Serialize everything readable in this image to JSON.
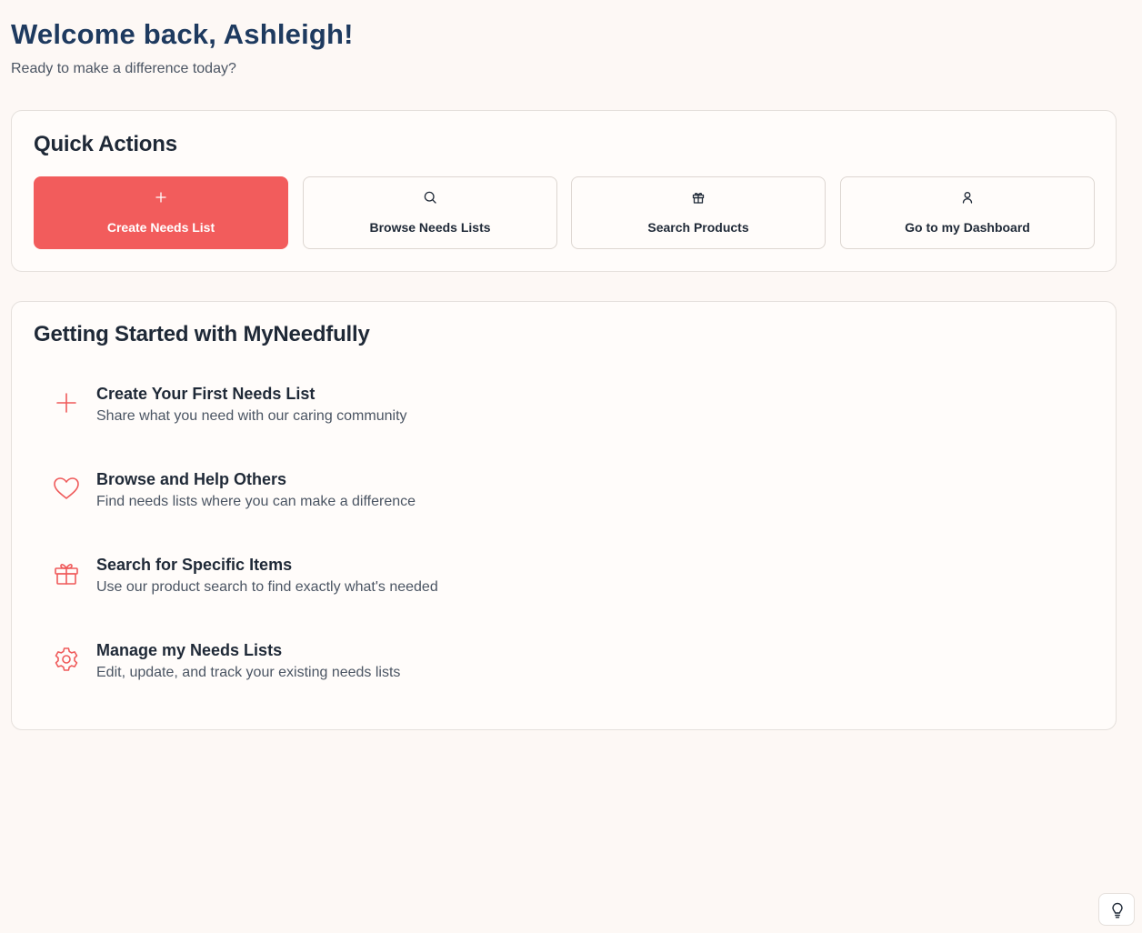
{
  "header": {
    "title": "Welcome back, Ashleigh!",
    "subtitle": "Ready to make a difference today?"
  },
  "quick_actions": {
    "title": "Quick Actions",
    "buttons": [
      {
        "label": "Create Needs List",
        "icon": "plus-icon"
      },
      {
        "label": "Browse Needs Lists",
        "icon": "search-icon"
      },
      {
        "label": "Search Products",
        "icon": "gift-icon"
      },
      {
        "label": "Go to my Dashboard",
        "icon": "user-icon"
      }
    ]
  },
  "getting_started": {
    "title": "Getting Started with MyNeedfully",
    "items": [
      {
        "title": "Create Your First Needs List",
        "description": "Share what you need with our caring community",
        "icon": "plus-icon"
      },
      {
        "title": "Browse and Help Others",
        "description": "Find needs lists where you can make a difference",
        "icon": "heart-icon"
      },
      {
        "title": "Search for Specific Items",
        "description": "Use our product search to find exactly what's needed",
        "icon": "gift-icon"
      },
      {
        "title": "Manage my Needs Lists",
        "description": "Edit, update, and track your existing needs lists",
        "icon": "gear-icon"
      }
    ]
  },
  "help_button": {
    "icon": "lightbulb-icon"
  },
  "colors": {
    "accent": "#f25c5c",
    "heading": "#1e3a5f",
    "background": "#fdf8f5"
  }
}
